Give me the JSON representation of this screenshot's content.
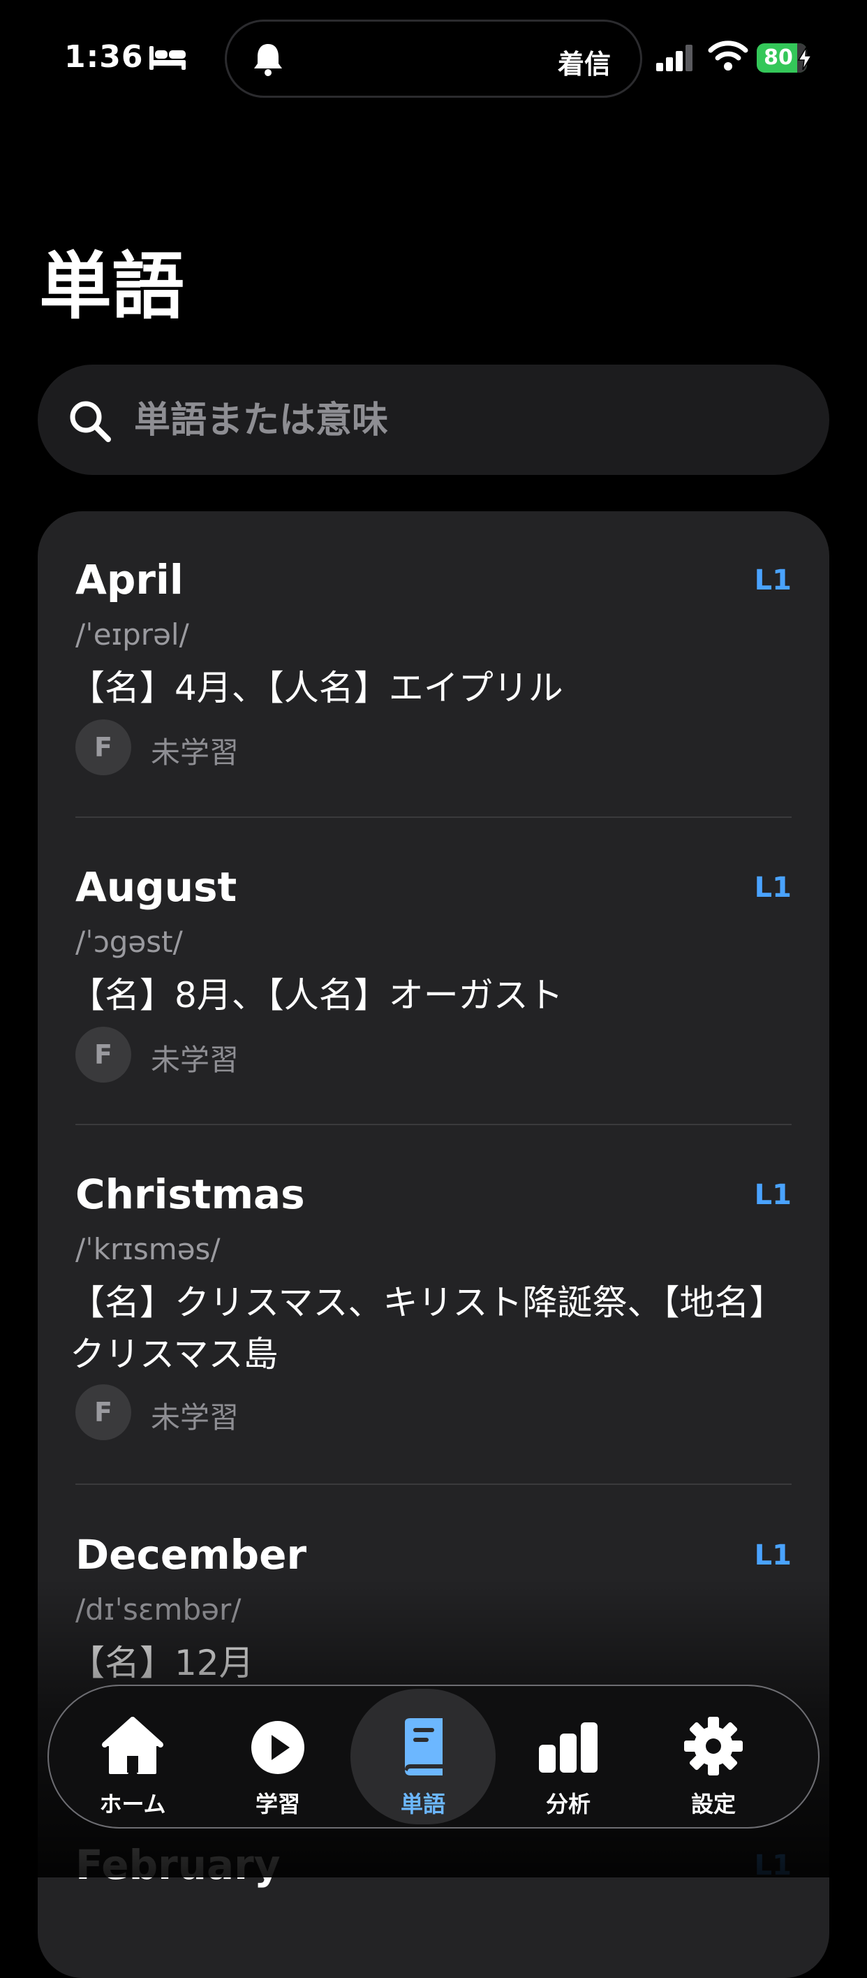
{
  "status_bar": {
    "time": "1:36",
    "island_text": "着信",
    "battery_level": "80"
  },
  "page": {
    "title": "単語"
  },
  "search": {
    "placeholder": "単語または意味"
  },
  "words": [
    {
      "word": "April",
      "level": "L1",
      "phonetic": "/ˈeɪprəl/",
      "meaning": "【名】4月、【人名】エイプリル",
      "grade": "F",
      "status": "未学習"
    },
    {
      "word": "August",
      "level": "L1",
      "phonetic": "/ˈɔgəst/",
      "meaning": "【名】8月、【人名】オーガスト",
      "grade": "F",
      "status": "未学習"
    },
    {
      "word": "Christmas",
      "level": "L1",
      "phonetic": "/ˈkrɪsməs/",
      "meaning": "【名】クリスマス、キリスト降誕祭、【地名】クリスマス島",
      "grade": "F",
      "status": "未学習"
    },
    {
      "word": "December",
      "level": "L1",
      "phonetic": "/dɪˈsɛmbər/",
      "meaning": "【名】12月"
    },
    {
      "word": "February",
      "level": "L1"
    }
  ],
  "tabs": [
    {
      "label": "ホーム",
      "icon": "home-icon"
    },
    {
      "label": "学習",
      "icon": "play-icon"
    },
    {
      "label": "単語",
      "icon": "book-icon",
      "active": true
    },
    {
      "label": "分析",
      "icon": "bar-chart-icon"
    },
    {
      "label": "設定",
      "icon": "gear-icon"
    }
  ],
  "colors": {
    "accent": "#4aa3ff",
    "tab_active": "#6cb7ff",
    "battery": "#34c759",
    "card": "#232325"
  }
}
